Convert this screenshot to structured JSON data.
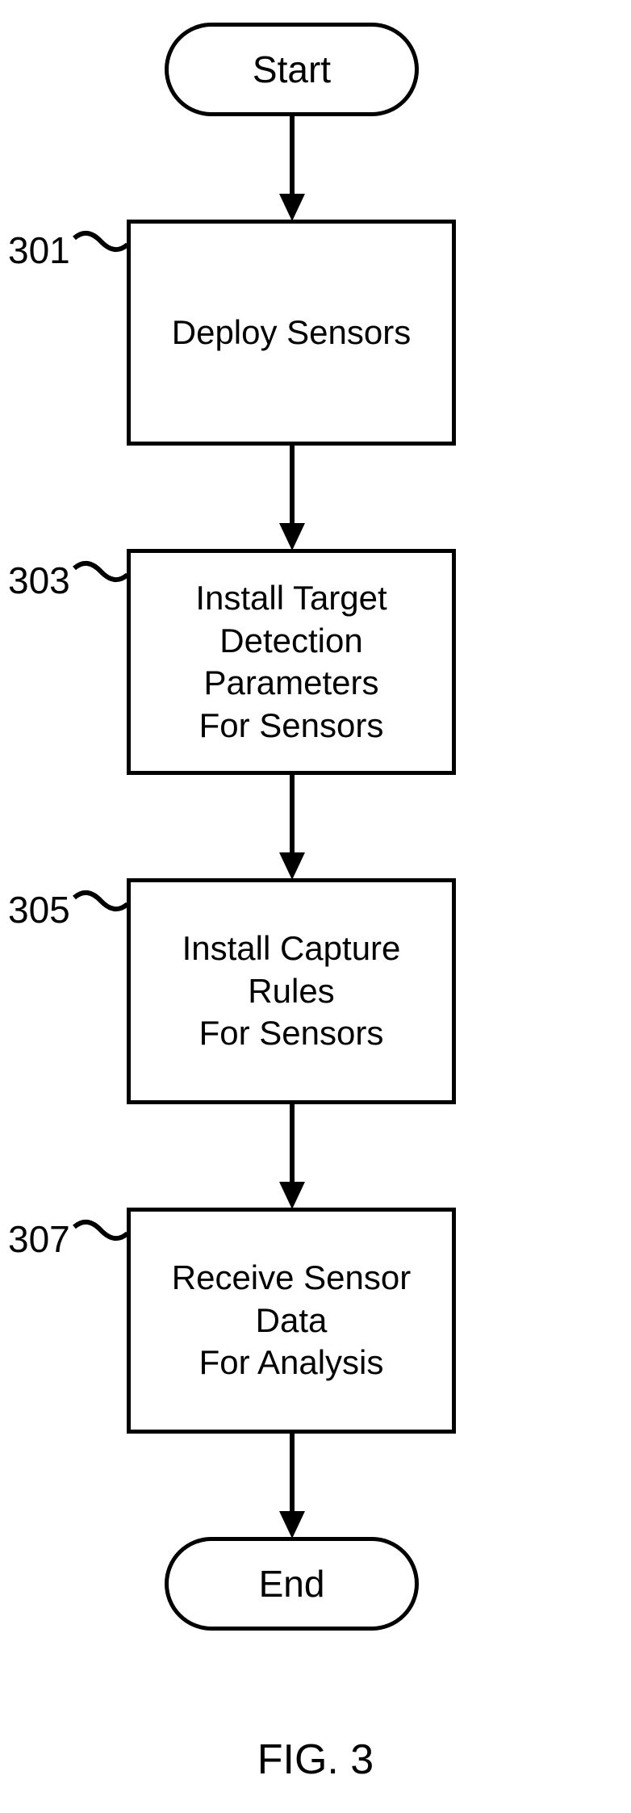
{
  "chart_data": {
    "type": "flowchart",
    "title": "FIG. 3",
    "nodes": [
      {
        "id": "start",
        "shape": "terminator",
        "label": "Start"
      },
      {
        "id": "n301",
        "shape": "process",
        "ref": "301",
        "label": "Deploy Sensors"
      },
      {
        "id": "n303",
        "shape": "process",
        "ref": "303",
        "label": "Install Target Detection Parameters For Sensors"
      },
      {
        "id": "n305",
        "shape": "process",
        "ref": "305",
        "label": "Install Capture Rules For Sensors"
      },
      {
        "id": "n307",
        "shape": "process",
        "ref": "307",
        "label": "Receive Sensor Data For Analysis"
      },
      {
        "id": "end",
        "shape": "terminator",
        "label": "End"
      }
    ],
    "edges": [
      {
        "from": "start",
        "to": "n301"
      },
      {
        "from": "n301",
        "to": "n303"
      },
      {
        "from": "n303",
        "to": "n305"
      },
      {
        "from": "n305",
        "to": "n307"
      },
      {
        "from": "n307",
        "to": "end"
      }
    ]
  },
  "terminators": {
    "start": "Start",
    "end": "End"
  },
  "steps": {
    "s301": {
      "ref": "301",
      "label": "Deploy Sensors"
    },
    "s303": {
      "ref": "303",
      "label": "Install Target\nDetection Parameters\nFor Sensors"
    },
    "s305": {
      "ref": "305",
      "label": "Install Capture Rules\nFor Sensors"
    },
    "s307": {
      "ref": "307",
      "label": "Receive Sensor Data\nFor Analysis"
    }
  },
  "figure_label": "FIG. 3"
}
